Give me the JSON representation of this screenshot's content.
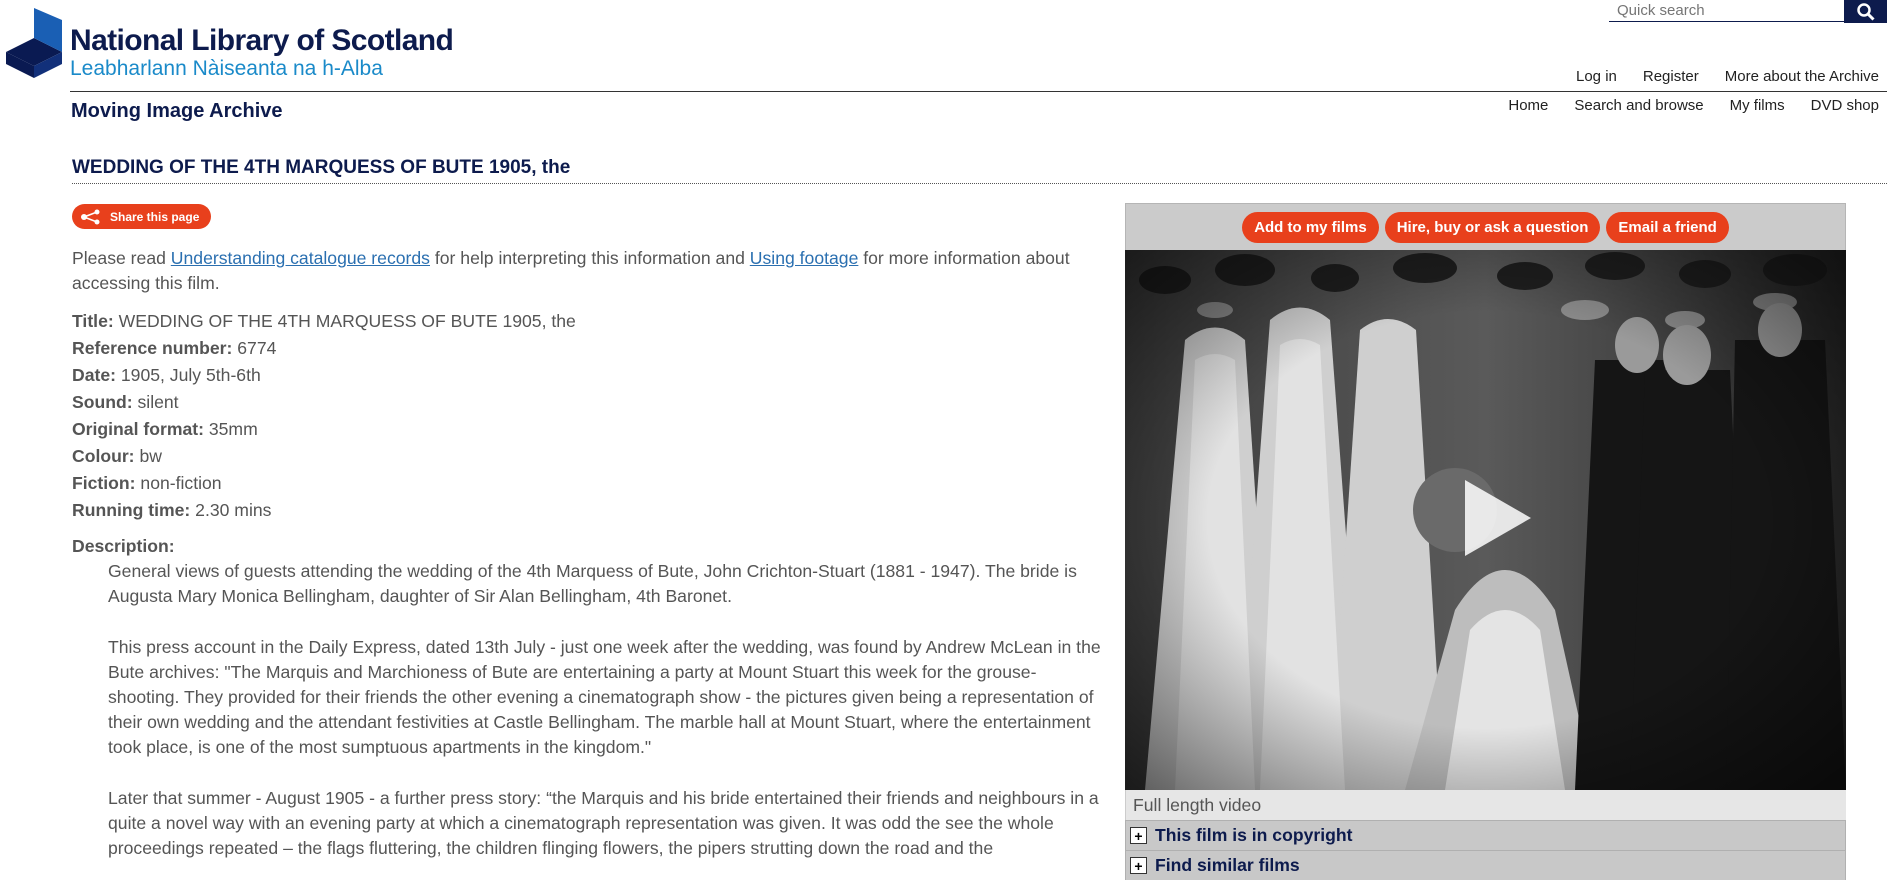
{
  "brand": {
    "name": "National Library of Scotland",
    "gaelic_name": "Leabharlann Nàiseanta na h-Alba",
    "section": "Moving Image Archive",
    "logo_color": "#1a5fb4",
    "navy": "#0d1b4d",
    "accent": "#e8401c"
  },
  "search": {
    "placeholder": "Quick search",
    "icon": "search-icon"
  },
  "account_nav": [
    "Log in",
    "Register",
    "More about the Archive"
  ],
  "main_nav": [
    "Home",
    "Search and browse",
    "My films",
    "DVD shop"
  ],
  "page": {
    "title": "WEDDING OF THE 4TH MARQUESS OF BUTE 1905, the",
    "share_label": "Share this page",
    "intro": {
      "pre": "Please read ",
      "link1": "Understanding catalogue records",
      "mid": " for help interpreting this information and ",
      "link2": "Using footage",
      "post": " for more information about accessing this film."
    },
    "fields": [
      {
        "label": "Title:",
        "value": "WEDDING OF THE 4TH MARQUESS OF BUTE 1905, the"
      },
      {
        "label": "Reference number:",
        "value": "6774"
      },
      {
        "label": "Date:",
        "value": "1905, July 5th-6th"
      },
      {
        "label": "Sound:",
        "value": "silent"
      },
      {
        "label": "Original format:",
        "value": "35mm"
      },
      {
        "label": "Colour:",
        "value": "bw"
      },
      {
        "label": "Fiction:",
        "value": "non-fiction"
      },
      {
        "label": "Running time:",
        "value": "2.30 mins"
      }
    ],
    "description_label": "Description:",
    "description": [
      "General views of guests attending the wedding of the 4th Marquess of Bute, John Crichton-Stuart (1881 - 1947). The bride is Augusta Mary Monica Bellingham, daughter of Sir Alan Bellingham, 4th Baronet.",
      "This press account in the Daily Express, dated 13th July - just one week after the wedding, was found by Andrew McLean in the Bute archives: \"The Marquis and Marchioness of Bute are entertaining a party at Mount Stuart this week for the grouse-shooting. They provided for their friends the other evening a cinematograph show - the pictures given being a representation of their own wedding and the attendant festivities at Castle Bellingham. The marble hall at Mount Stuart, where the entertainment took place, is one of the most sumptuous apartments in the kingdom.\"",
      "Later that summer - August 1905 - a further press story: “the Marquis and his bride entertained their friends and neighbours in a quite a novel way with an evening party at which a cinematograph representation was given. It was odd the see the whole proceedings repeated – the flags fluttering, the children flinging flowers, the pipers strutting down the road and the"
    ]
  },
  "sidebar": {
    "actions": [
      "Add to my films",
      "Hire, buy or ask a question",
      "Email a friend"
    ],
    "video_caption": "Full length video",
    "accordions": [
      "This film is in copyright",
      "Find similar films"
    ]
  }
}
